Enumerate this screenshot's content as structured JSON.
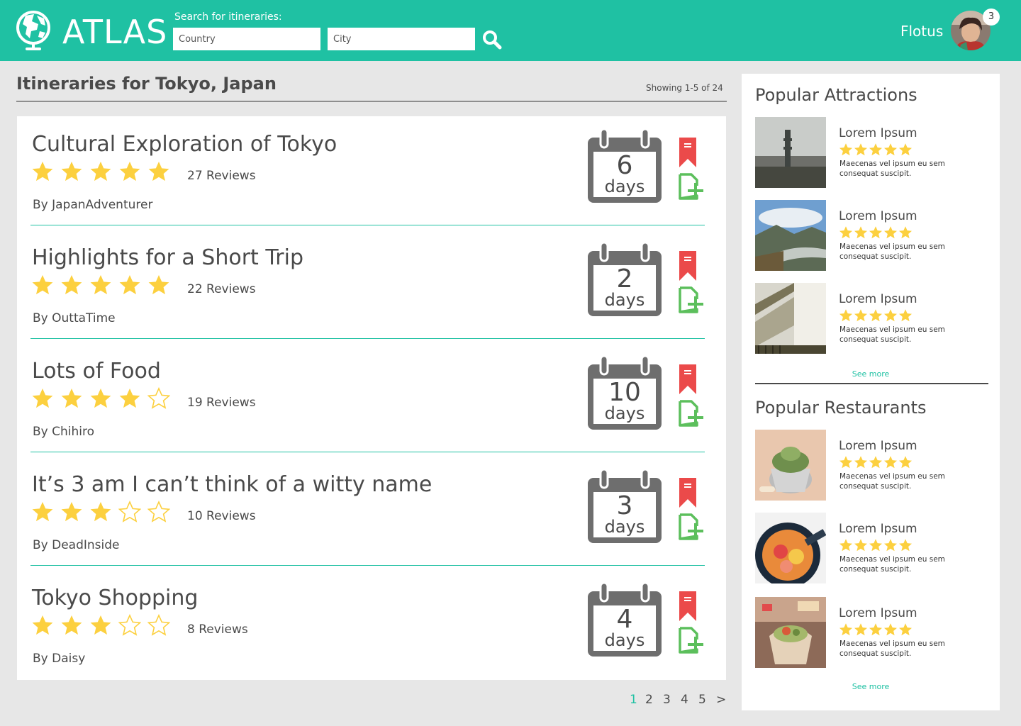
{
  "header": {
    "brand": "ATLAS",
    "search_label": "Search for itineraries:",
    "country_placeholder": "Country",
    "city_placeholder": "City",
    "user_name": "Flotus",
    "notifications": "3",
    "accent_color": "#1fc1a3"
  },
  "results": {
    "title": "Itineraries for Tokyo, Japan",
    "showing": "Showing 1-5 of 24"
  },
  "itineraries": [
    {
      "title": "Cultural Exploration of Tokyo",
      "rating": 5,
      "reviews": "27 Reviews",
      "author": "By JapanAdventurer",
      "days_num": "6",
      "days_unit": "days"
    },
    {
      "title": "Highlights for a Short Trip",
      "rating": 5,
      "reviews": "22 Reviews",
      "author": "By OuttaTime",
      "days_num": "2",
      "days_unit": "days"
    },
    {
      "title": "Lots of Food",
      "rating": 4,
      "reviews": "19 Reviews",
      "author": "By Chihiro",
      "days_num": "10",
      "days_unit": "days"
    },
    {
      "title": "It’s 3 am I can’t think of a witty name",
      "rating": 3,
      "reviews": "10 Reviews",
      "author": "By DeadInside",
      "days_num": "3",
      "days_unit": "days"
    },
    {
      "title": "Tokyo Shopping",
      "rating": 3,
      "reviews": "8 Reviews",
      "author": "By Daisy",
      "days_num": "4",
      "days_unit": "days"
    }
  ],
  "pagination": [
    "1",
    "2",
    "3",
    "4",
    "5",
    ">"
  ],
  "sidebar": {
    "attractions_heading": "Popular Attractions",
    "attractions": [
      {
        "name": "Lorem Ipsum",
        "rating": 5,
        "desc": "Maecenas vel ipsum eu sem consequat suscipit."
      },
      {
        "name": "Lorem Ipsum",
        "rating": 5,
        "desc": "Maecenas vel ipsum eu sem consequat suscipit."
      },
      {
        "name": "Lorem Ipsum",
        "rating": 5,
        "desc": "Maecenas vel ipsum eu sem consequat suscipit."
      }
    ],
    "see_more_1": "See more",
    "restaurants_heading": "Popular Restaurants",
    "restaurants": [
      {
        "name": "Lorem Ipsum",
        "rating": 5,
        "desc": "Maecenas vel ipsum eu sem consequat suscipit."
      },
      {
        "name": "Lorem Ipsum",
        "rating": 5,
        "desc": "Maecenas vel ipsum eu sem consequat suscipit."
      },
      {
        "name": "Lorem Ipsum",
        "rating": 5,
        "desc": "Maecenas vel ipsum eu sem consequat suscipit."
      }
    ],
    "see_more_2": "See more"
  }
}
